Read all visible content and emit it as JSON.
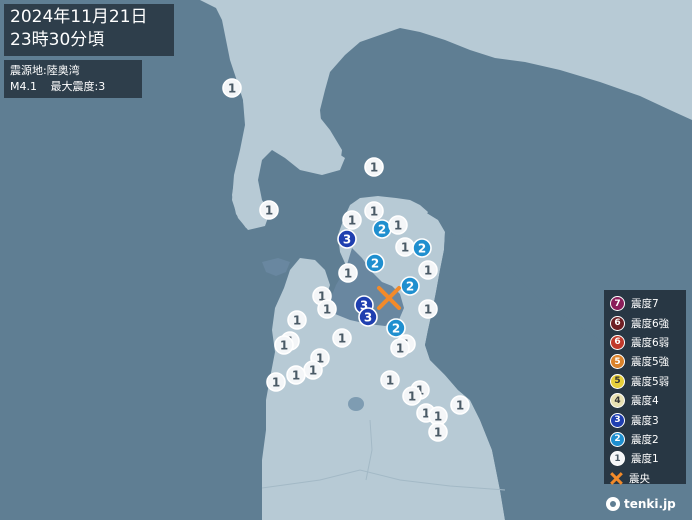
{
  "header": {
    "date": "2024年11月21日",
    "time": "23時30分頃"
  },
  "quake_info": {
    "epicenter_label": "震源地:陸奥湾",
    "magnitude": "M4.1",
    "max_intensity": "最大震度:3"
  },
  "legend": [
    {
      "symbol": "7",
      "label": "震度7",
      "color": "#8a1e5a",
      "text_color": "#ffffff"
    },
    {
      "symbol": "6+",
      "label": "震度6強",
      "color": "#6e1f24",
      "text_color": "#ffffff"
    },
    {
      "symbol": "6-",
      "label": "震度6弱",
      "color": "#c0392b",
      "text_color": "#ffffff"
    },
    {
      "symbol": "5+",
      "label": "震度5強",
      "color": "#d9822b",
      "text_color": "#ffffff"
    },
    {
      "symbol": "5-",
      "label": "震度5弱",
      "color": "#e6cf3a",
      "text_color": "#333333"
    },
    {
      "symbol": "4",
      "label": "震度4",
      "color": "#e8e1b3",
      "text_color": "#333333"
    },
    {
      "symbol": "3",
      "label": "震度3",
      "color": "#1f3fb0",
      "text_color": "#ffffff"
    },
    {
      "symbol": "2",
      "label": "震度2",
      "color": "#1f8fcf",
      "text_color": "#ffffff"
    },
    {
      "symbol": "1",
      "label": "震度1",
      "color": "#f4f6f8",
      "text_color": "#4a5a66"
    },
    {
      "symbol": "x",
      "label": "震央",
      "color": "#f28a2a",
      "text_color": "#ffffff"
    }
  ],
  "brand": "tenki.jp",
  "colors": {
    "sea": "#5f7e93",
    "land": "#b9ccd6",
    "intensity_3": "#1f3fb0",
    "intensity_2": "#1f8fcf",
    "intensity_1": "#f4f6f8",
    "epicenter": "#f28a2a"
  }
}
